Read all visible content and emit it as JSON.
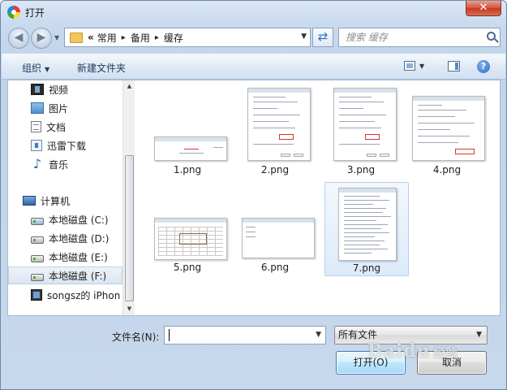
{
  "window": {
    "title": "打开",
    "close_glyph": "✕"
  },
  "address": {
    "lead": "«",
    "crumbs": [
      "常用",
      "备用",
      "缓存"
    ],
    "separator": "▸"
  },
  "search": {
    "placeholder": "搜索 缓存"
  },
  "toolbar": {
    "organize": "组织",
    "new_folder": "新建文件夹",
    "help": "?"
  },
  "nav": {
    "favorites": [
      {
        "label": "视频",
        "icon": "video-icon"
      },
      {
        "label": "图片",
        "icon": "picture-icon"
      },
      {
        "label": "文档",
        "icon": "document-icon"
      },
      {
        "label": "迅雷下载",
        "icon": "download-icon"
      },
      {
        "label": "音乐",
        "icon": "music-icon"
      }
    ],
    "computer": {
      "label": "计算机",
      "icon": "computer-icon"
    },
    "drives": [
      {
        "label": "本地磁盘 (C:)",
        "icon": "system-drive-icon"
      },
      {
        "label": "本地磁盘 (D:)",
        "icon": "drive-icon"
      },
      {
        "label": "本地磁盘 (E:)",
        "icon": "drive-icon"
      },
      {
        "label": "本地磁盘 (F:)",
        "icon": "drive-icon",
        "selected": true
      },
      {
        "label": "songsz的 iPhon",
        "icon": "phone-icon"
      }
    ]
  },
  "files": [
    {
      "name": "1.png",
      "kind": "wide-search"
    },
    {
      "name": "2.png",
      "kind": "dialog"
    },
    {
      "name": "3.png",
      "kind": "dialog"
    },
    {
      "name": "4.png",
      "kind": "dialog-form"
    },
    {
      "name": "5.png",
      "kind": "wide-grid"
    },
    {
      "name": "6.png",
      "kind": "wide-blank"
    },
    {
      "name": "7.png",
      "kind": "tall-list",
      "selected": true
    }
  ],
  "bottom": {
    "filename_label": "文件名(N):",
    "filename_value": "",
    "file_type": "所有文件",
    "open_button": "打开(O)",
    "cancel_button": "取消"
  },
  "watermark": {
    "text": "Baidu",
    "suffix": "经验"
  },
  "colors": {
    "close_button": "#c43a22",
    "accent": "#3c7fb1",
    "selection": "#dceaf9"
  }
}
